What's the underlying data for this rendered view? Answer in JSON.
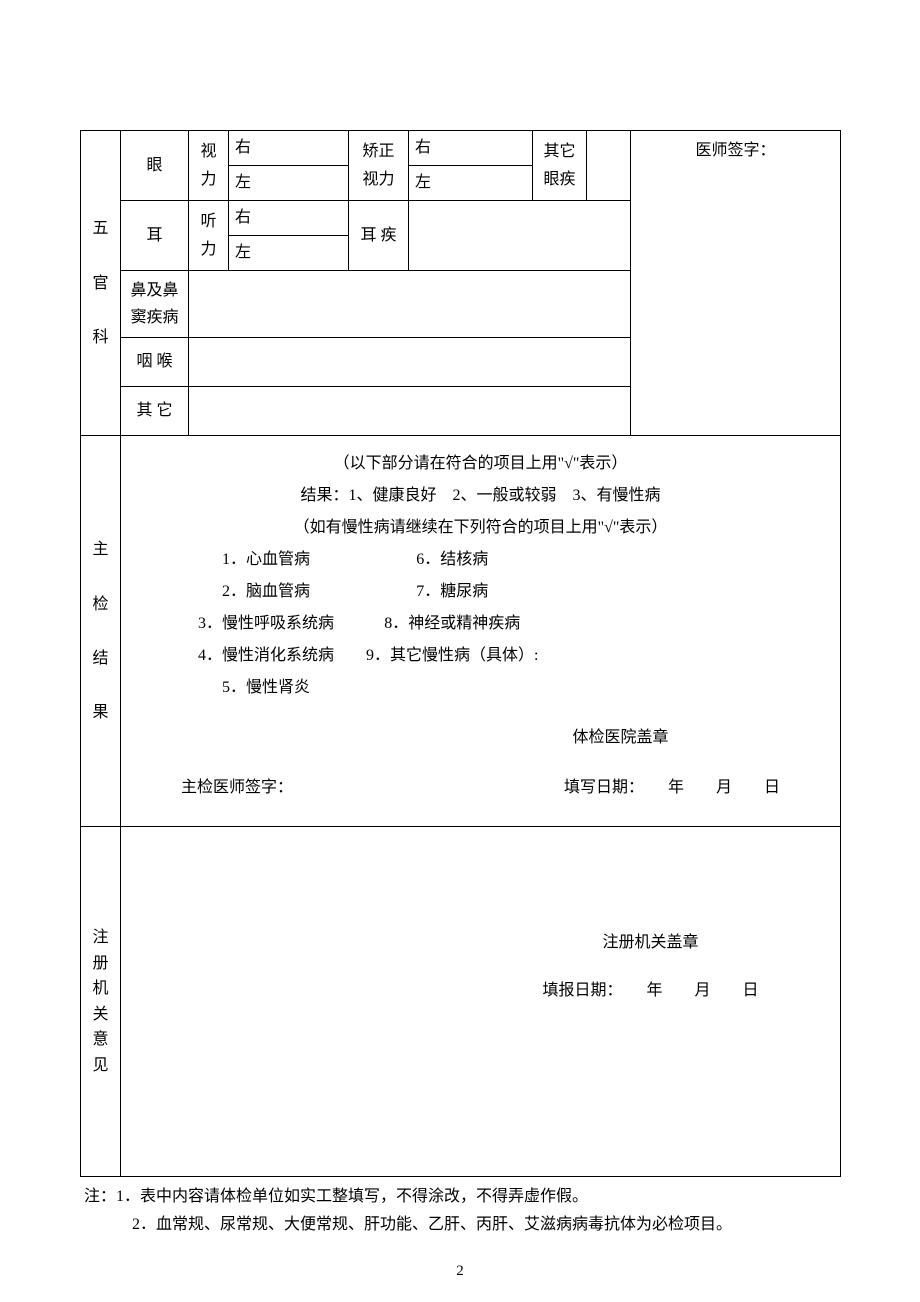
{
  "sections": {
    "wuguan": "五\n\n官\n\n科",
    "zhujian": "主\n\n检\n\n结\n\n果",
    "zhuce": "注\n册\n机\n关\n意\n见"
  },
  "eye": {
    "label": "眼",
    "vision": "视\n力",
    "right": "右",
    "left": "左",
    "corrected": "矫正\n视力",
    "other_disease": "其它\n眼疾"
  },
  "ear": {
    "label": "耳",
    "hearing": "听\n力",
    "right": "右",
    "left": "左",
    "disease": "耳 疾"
  },
  "rows": {
    "nose": "鼻及鼻\n窦疾病",
    "throat": "咽 喉",
    "other": "其 它"
  },
  "doctor_sig": "医师签字：",
  "main_check": {
    "intro": "（以下部分请在符合的项目上用\"√\"表示）",
    "result_line": "结果：1、健康良好　2、一般或较弱　3、有慢性病",
    "chronic_note": "（如有慢性病请继续在下列符合的项目上用\"√\"表示）",
    "d1": "1．心血管病",
    "d2": "2．脑血管病",
    "d3": "3．慢性呼吸系统病",
    "d4": "4．慢性消化系统病",
    "d5": "5．慢性肾炎",
    "d6": "6．结核病",
    "d7": "7．糖尿病",
    "d8": "8．神经或精神疾病",
    "d9": "9．其它慢性病（具体）:",
    "hospital_stamp": "体检医院盖章",
    "chief_sig": "主检医师签字：",
    "fill_date": "填写日期：　　年　　月　　日"
  },
  "registration": {
    "stamp": "注册机关盖章",
    "fill_date": "填报日期：　　年　　月　　日"
  },
  "notes": {
    "prefix": "注：",
    "n1": "1．表中内容请体检单位如实工整填写，不得涂改，不得弄虚作假。",
    "n2": "2．血常规、尿常规、大便常规、肝功能、乙肝、丙肝、艾滋病病毒抗体为必检项目。"
  },
  "page": "2"
}
